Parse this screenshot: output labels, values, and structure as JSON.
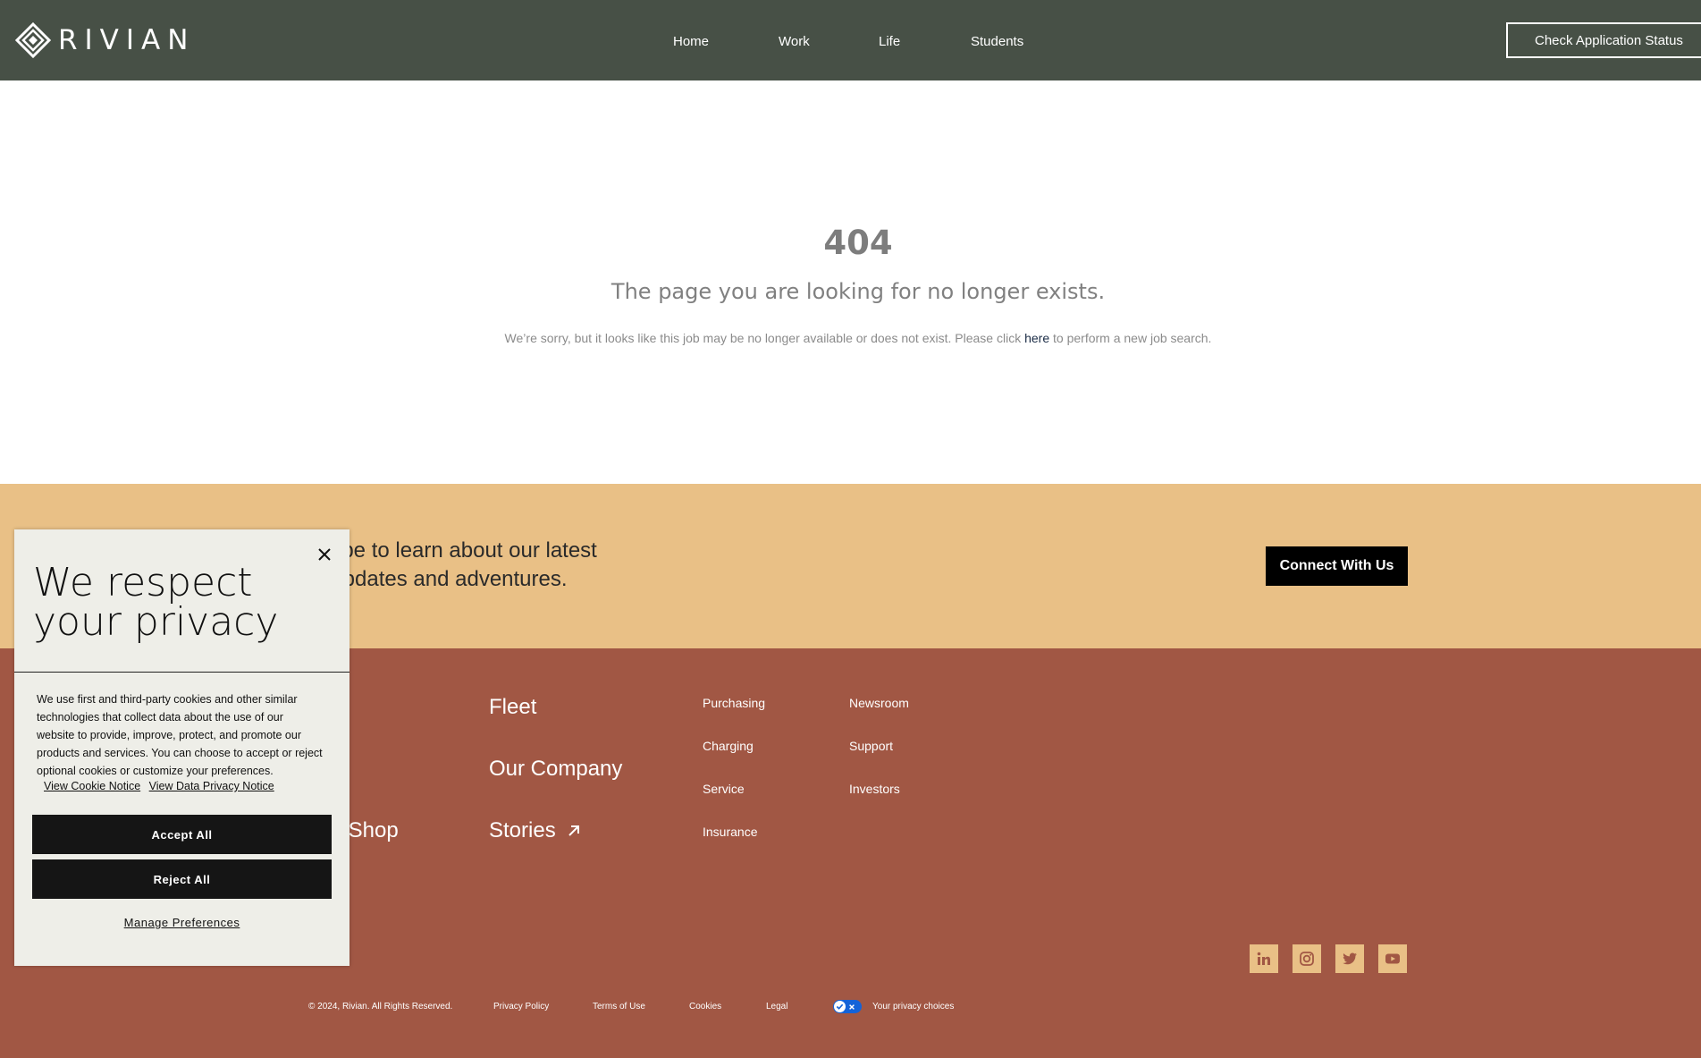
{
  "header": {
    "logo_text": "RIVIAN",
    "nav": [
      "Home",
      "Work",
      "Life",
      "Students"
    ],
    "status_button": "Check Application Status"
  },
  "error": {
    "code": "404",
    "title": "The page you are looking for no longer exists.",
    "message_before": "We’re sorry, but it looks like this job may be no longer available or does not exist. Please click ",
    "link_text": "here",
    "message_after": " to perform a new job search."
  },
  "subscribe": {
    "line1": "scribe to learn about our latest",
    "line2": "s, updates and adventures.",
    "button": "Connect With Us"
  },
  "footer": {
    "big_links": [
      "r Shop",
      "Fleet",
      "Our Company",
      "Stories"
    ],
    "col1": [
      "Purchasing",
      "Charging",
      "Service",
      "Insurance"
    ],
    "col2": [
      "Newsroom",
      "Support",
      "Investors"
    ],
    "legal": {
      "copyright": "© 2024, Rivian. All Rights Reserved.",
      "privacy_policy": "Privacy Policy",
      "terms": "Terms of Use",
      "cookies": "Cookies",
      "legal": "Legal",
      "privacy_choices": "Your privacy choices"
    },
    "social_icons": [
      "linkedin-icon",
      "instagram-icon",
      "twitter-icon",
      "youtube-icon"
    ]
  },
  "cookie": {
    "title_line1": "We respect",
    "title_line2": "your privacy",
    "body": "We use first and third-party cookies and other similar technologies that collect data about the use of our website to provide, improve, protect, and promote our products and services. You can choose to accept or reject optional cookies or customize your preferences.",
    "cookie_notice": "View Cookie Notice",
    "data_privacy_notice": "View Data Privacy Notice",
    "accept": "Accept All",
    "reject": "Reject All",
    "manage": "Manage Preferences"
  },
  "colors": {
    "header_bg": "#475046",
    "subscribe_bg": "#e9c086",
    "footer_bg": "#a15744",
    "cookie_bg": "#eeeee8"
  }
}
